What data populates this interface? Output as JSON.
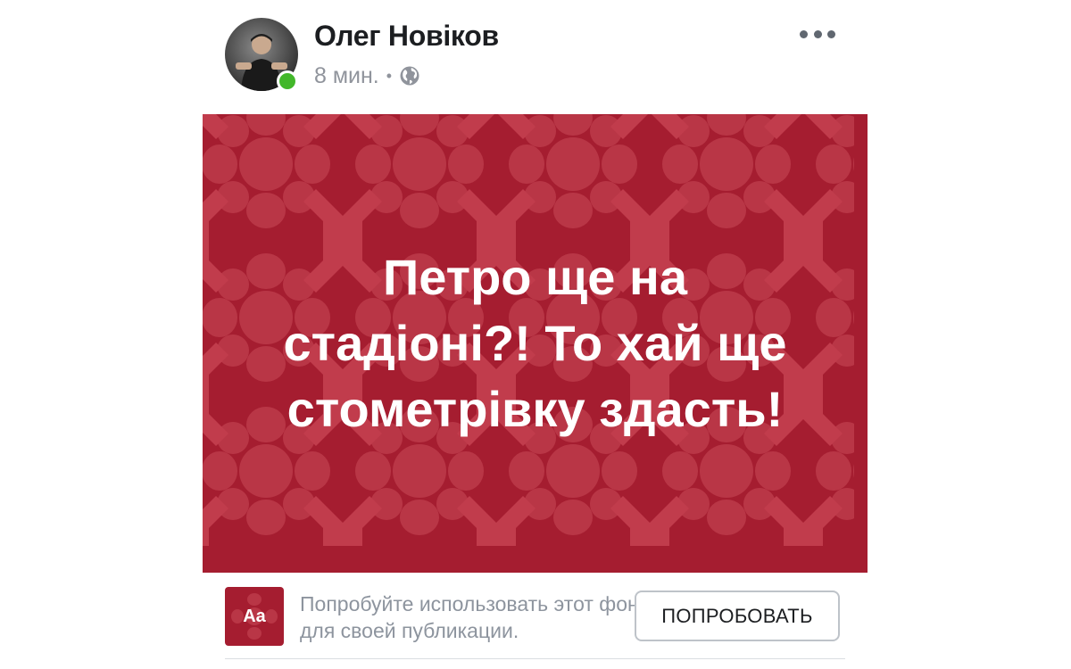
{
  "post": {
    "author": "Олег Новіков",
    "time": "8 мин.",
    "separator": "•",
    "privacy_icon": "globe-icon",
    "menu_icon": "more-horizontal-icon",
    "online": true
  },
  "background_post": {
    "text": "Петро ще на стадіоні?! То хай ще стометрівку здасть!",
    "colors": {
      "background": "#a51d30",
      "pattern": "#b93646",
      "text": "#ffffff"
    }
  },
  "try_background": {
    "thumbnail_label": "Aa",
    "prompt": "Попробуйте использовать этот фон для своей публикации.",
    "button_label": "ПОПРОБОВАТЬ"
  },
  "colors": {
    "online": "#42b72a",
    "meta_text": "#90949c"
  }
}
